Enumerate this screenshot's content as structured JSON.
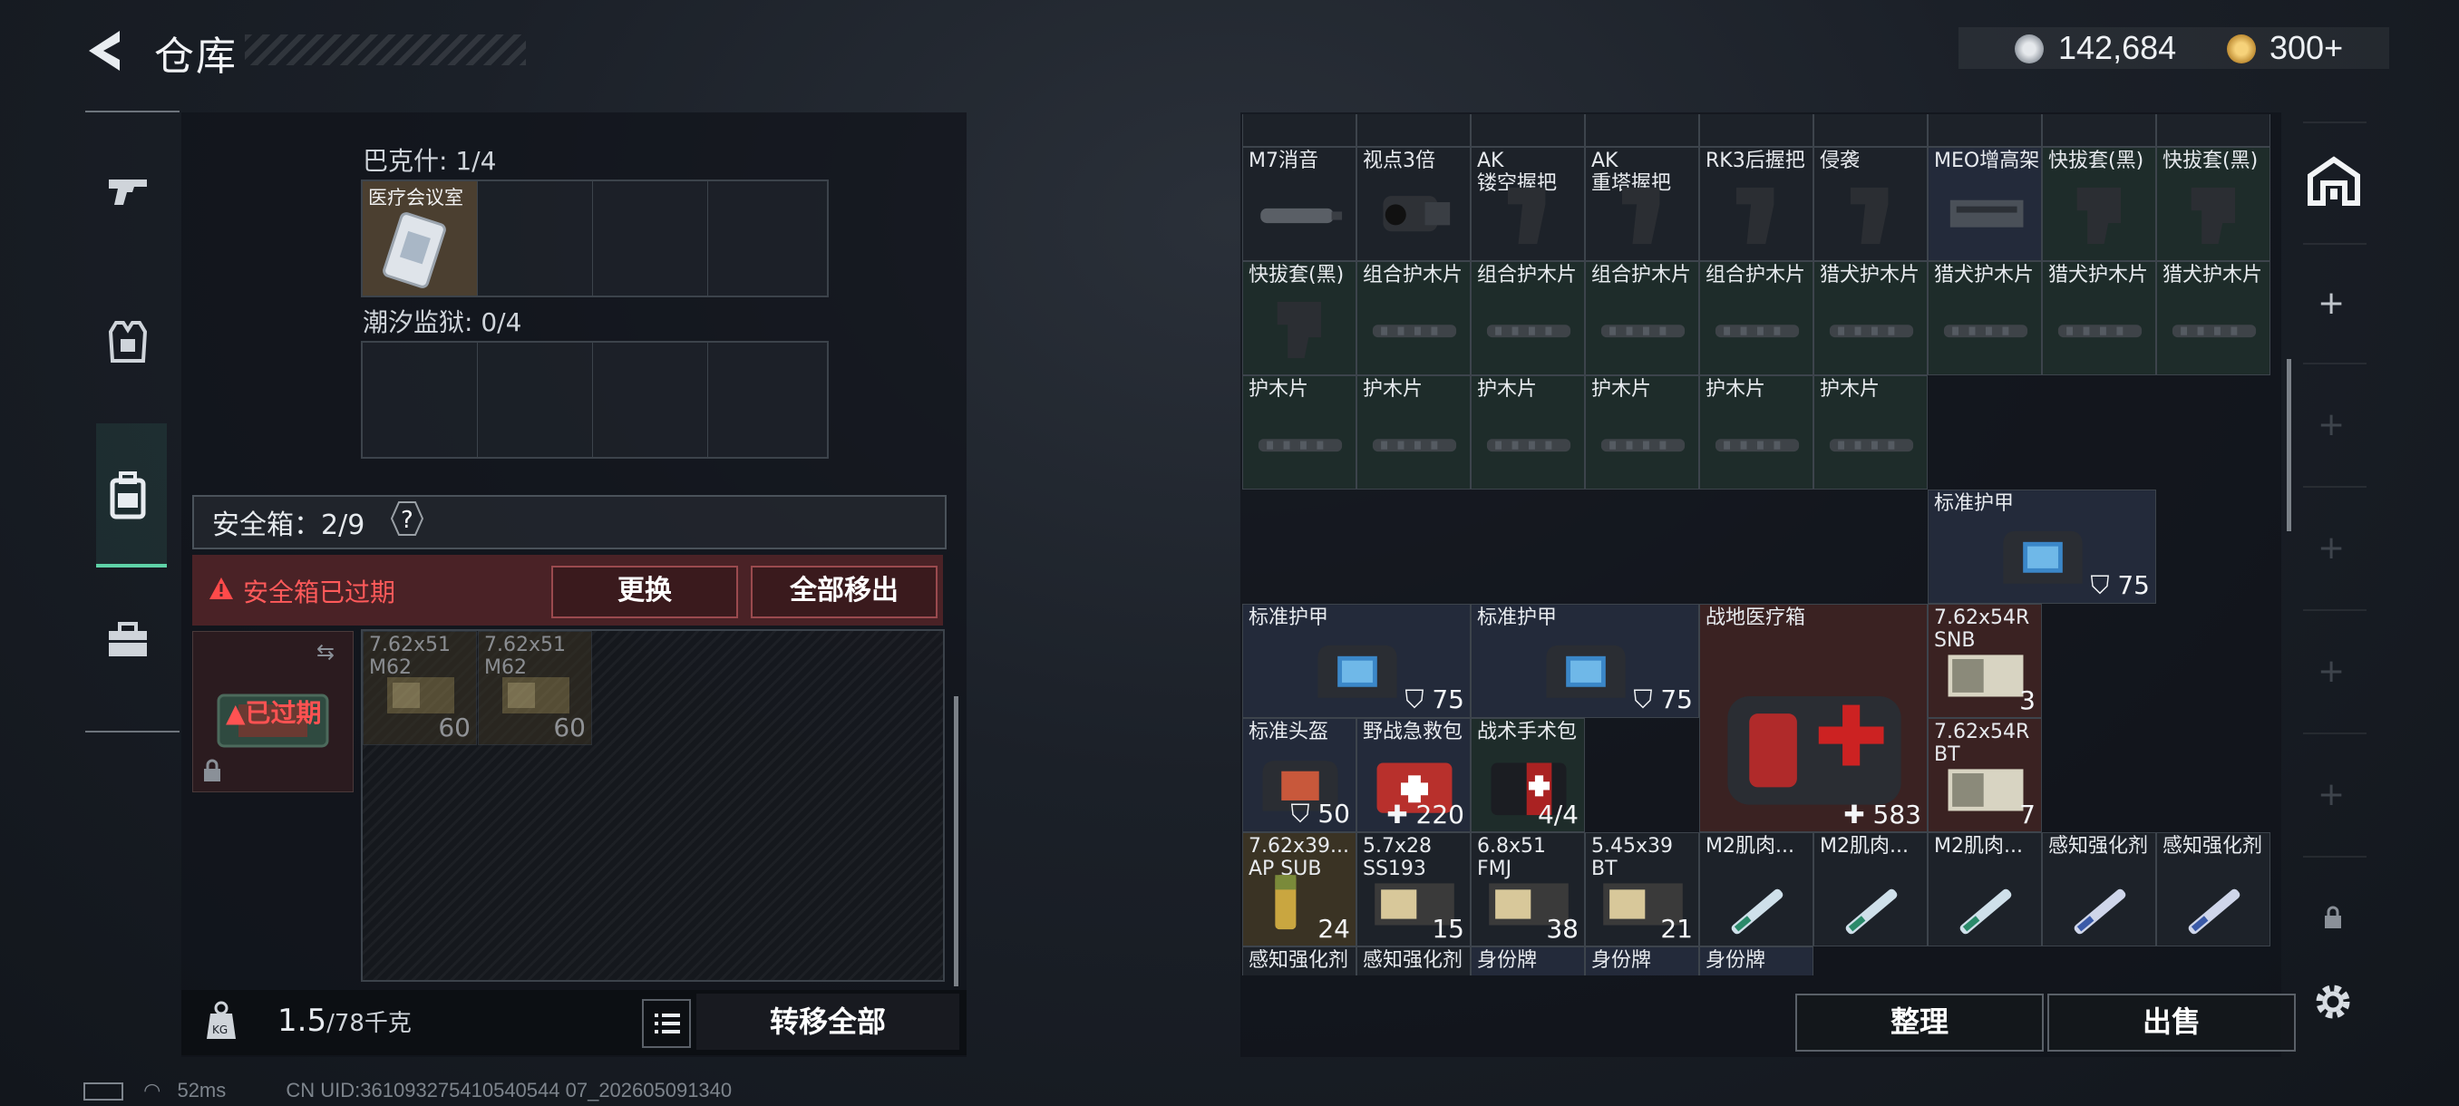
{
  "header": {
    "title": "仓库",
    "currency": [
      {
        "icon": "silver-coin-icon",
        "value": "142,684"
      },
      {
        "icon": "gold-coin-icon",
        "value": "300+"
      }
    ]
  },
  "left": {
    "section1": {
      "label": "巴克什: 1/4",
      "item_name": "医疗会议室"
    },
    "section2": {
      "label": "潮汐监狱: 0/4"
    },
    "safebox": {
      "label": "安全箱：2/9",
      "help": "?",
      "expired_msg": "安全箱已过期",
      "replace_btn": "更换",
      "remove_all_btn": "全部移出",
      "icon_status": "已过期",
      "items": [
        {
          "name": "7.62x51\nM62",
          "qty": "60"
        },
        {
          "name": "7.62x51\nM62",
          "qty": "60"
        }
      ]
    },
    "weight": {
      "value": "1.5",
      "max": "/78千克"
    },
    "transfer_all": "转移全部"
  },
  "inventory": {
    "rows": [
      [
        {
          "n": "M7消音",
          "c": "c-gray",
          "a": "suppressor"
        },
        {
          "n": "视点3倍",
          "c": "c-gray",
          "a": "scope"
        },
        {
          "n": "AK\n镂空握把",
          "c": "c-gray",
          "a": "grip"
        },
        {
          "n": "AK\n重塔握把",
          "c": "c-gray",
          "a": "grip"
        },
        {
          "n": "RK3后握把",
          "c": "c-gray",
          "a": "grip"
        },
        {
          "n": "侵袭",
          "c": "c-gray",
          "a": "grip"
        },
        {
          "n": "MEO增高架",
          "c": "c-blue",
          "a": "mount"
        },
        {
          "n": "快拔套(黑)",
          "c": "c-green",
          "a": "holster"
        },
        {
          "n": "快拔套(黑)",
          "c": "c-green",
          "a": "holster"
        }
      ],
      [
        {
          "n": "快拔套(黑)",
          "c": "c-green",
          "a": "holster"
        },
        {
          "n": "组合护木片",
          "c": "c-green",
          "a": "rail"
        },
        {
          "n": "组合护木片",
          "c": "c-green",
          "a": "rail"
        },
        {
          "n": "组合护木片",
          "c": "c-green",
          "a": "rail"
        },
        {
          "n": "组合护木片",
          "c": "c-green",
          "a": "rail"
        },
        {
          "n": "猎犬护木片",
          "c": "c-green",
          "a": "rail"
        },
        {
          "n": "猎犬护木片",
          "c": "c-green",
          "a": "rail"
        },
        {
          "n": "猎犬护木片",
          "c": "c-green",
          "a": "rail"
        },
        {
          "n": "猎犬护木片",
          "c": "c-green",
          "a": "rail"
        }
      ],
      [
        {
          "n": "护木片",
          "c": "c-green",
          "a": "rail"
        },
        {
          "n": "护木片",
          "c": "c-green",
          "a": "rail"
        },
        {
          "n": "护木片",
          "c": "c-green",
          "a": "rail"
        },
        {
          "n": "护木片",
          "c": "c-green",
          "a": "rail"
        },
        {
          "n": "护木片",
          "c": "c-green",
          "a": "rail"
        },
        {
          "n": "护木片",
          "c": "c-green",
          "a": "rail"
        }
      ]
    ],
    "big": [
      {
        "n": "标准护甲",
        "q": "75",
        "c": "c-blue"
      },
      {
        "n": "标准护甲",
        "q": "75",
        "c": "c-blue"
      },
      {
        "n": "标准护甲",
        "q": "75",
        "c": "c-blue"
      },
      {
        "n": "战地医疗箱",
        "q": "583",
        "c": "c-red"
      },
      {
        "n": "7.62x54R\nSNB",
        "q": "3",
        "c": "c-red"
      },
      {
        "n": "标准头盔",
        "q": "50",
        "c": "c-blue"
      },
      {
        "n": "野战急救包",
        "q": "220",
        "c": "c-blue"
      },
      {
        "n": "战术手术包",
        "q": "4/4",
        "c": "c-green"
      },
      {
        "n": "7.62x54R\nBT",
        "q": "7",
        "c": "c-red"
      }
    ],
    "row6": [
      {
        "n": "7.62x39...\nAP SUB",
        "q": "24",
        "c": "c-gold"
      },
      {
        "n": "5.7x28\nSS193",
        "q": "15",
        "c": "c-gray"
      },
      {
        "n": "6.8x51\nFMJ",
        "q": "38",
        "c": "c-gray"
      },
      {
        "n": "5.45x39\nBT",
        "q": "21",
        "c": "c-gray"
      },
      {
        "n": "M2肌肉...",
        "q": "",
        "c": "c-gray"
      },
      {
        "n": "M2肌肉...",
        "q": "",
        "c": "c-gray"
      },
      {
        "n": "M2肌肉...",
        "q": "",
        "c": "c-gray"
      },
      {
        "n": "感知强化剂",
        "q": "",
        "c": "c-gray"
      },
      {
        "n": "感知强化剂",
        "q": "",
        "c": "c-gray"
      }
    ],
    "row7": [
      {
        "n": "感知强化剂",
        "c": "c-gray"
      },
      {
        "n": "感知强化剂",
        "c": "c-gray"
      },
      {
        "n": "身份牌",
        "c": "c-blue"
      },
      {
        "n": "身份牌",
        "c": "c-blue"
      },
      {
        "n": "身份牌",
        "c": "c-blue"
      }
    ]
  },
  "buttons": {
    "sort": "整理",
    "sell": "出售"
  },
  "status": {
    "ping": "52ms",
    "uid": "CN UID:361093275410540544 07_202605091340"
  }
}
